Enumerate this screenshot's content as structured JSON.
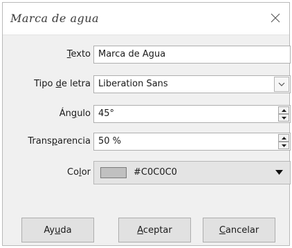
{
  "dialog": {
    "title": "Marca de agua"
  },
  "fields": {
    "text": {
      "label_pre": "",
      "label_ul": "T",
      "label_post": "exto",
      "value": "Marca de Agua"
    },
    "font": {
      "label_pre": "Tipo ",
      "label_ul": "d",
      "label_post": "e letra",
      "value": "Liberation Sans"
    },
    "angle": {
      "label_pre": "Án",
      "label_ul": "g",
      "label_post": "ulo",
      "value": "45°"
    },
    "transparency": {
      "label_pre": "Trans",
      "label_ul": "p",
      "label_post": "arencia",
      "value": "50 %"
    },
    "color": {
      "label_pre": "Co",
      "label_ul": "l",
      "label_post": "or",
      "value": "#C0C0C0",
      "swatch_hex": "#C0C0C0"
    }
  },
  "buttons": {
    "help": {
      "pre": "Ay",
      "ul": "u",
      "post": "da"
    },
    "ok": {
      "pre": "",
      "ul": "A",
      "post": "ceptar"
    },
    "cancel": {
      "pre": "",
      "ul": "C",
      "post": "ancelar"
    }
  },
  "icons": {
    "close": "close-icon",
    "combo": "chevron-down-icon",
    "spin_up": "spin-up-icon",
    "spin_down": "spin-down-icon",
    "dropdown": "triangle-down-icon"
  }
}
